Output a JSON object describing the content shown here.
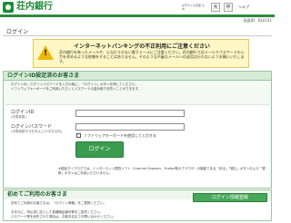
{
  "header": {
    "bank_name": "荘内銀行",
    "small_link": "文字サイズ変更 大 中",
    "help": "ヘルプ"
  },
  "screen_id": "画面ID：BL0101",
  "page_title": "ログイン",
  "warning": {
    "title": "インターネットバンキングの不正利用にご注意ください",
    "body": "荘内銀行を装ったメールや、心当たりのない電子メールにご注意ください。荘内銀行ではメールでパスワードの入力を求めるような依頼をすることはありません。そのような不審なメールへの返信は行わないようお願いいたします。"
  },
  "login": {
    "section_title": "ログインID設定済のお客さま",
    "notes": [
      "ログインID、ログインパスワードを入力の後に、「ログイン」ボタンを押してください。",
      "ソフトウェアキーボードをご利用いただくとパスワードの盗み取りを防ぐことができます。"
    ],
    "id_label": "ログインID",
    "id_sub": "(半角英数)",
    "id_value": "",
    "pw_label": "ログインパスワード",
    "pw_sub": "(半角英数字 6文字以上12文字以内)",
    "pw_value": "",
    "software_kb_label": "ソフトウェアキーボードを使用して入力する",
    "login_button": "ログイン",
    "note": "※認証ダイアログでは、インターネット閲覧ソフト（Internet Explorer、Firefox等のブラウザ）の機能である「戻る」「進む」ボタンおよび「更新」ボタンはご利用いただけません。"
  },
  "first_time": {
    "section_title": "初めてご利用のお客さま",
    "text": "初めてご利用のお客さまは、「ログイン情報」をご登録ください。",
    "register_button": "ログイン情報登録",
    "bullets": [
      "お手元に、申込書に記入した各種暗証番号等をご用意ください。",
      "パスワード等を紛失された場合は、お取引店までお問い合わせください。"
    ]
  }
}
